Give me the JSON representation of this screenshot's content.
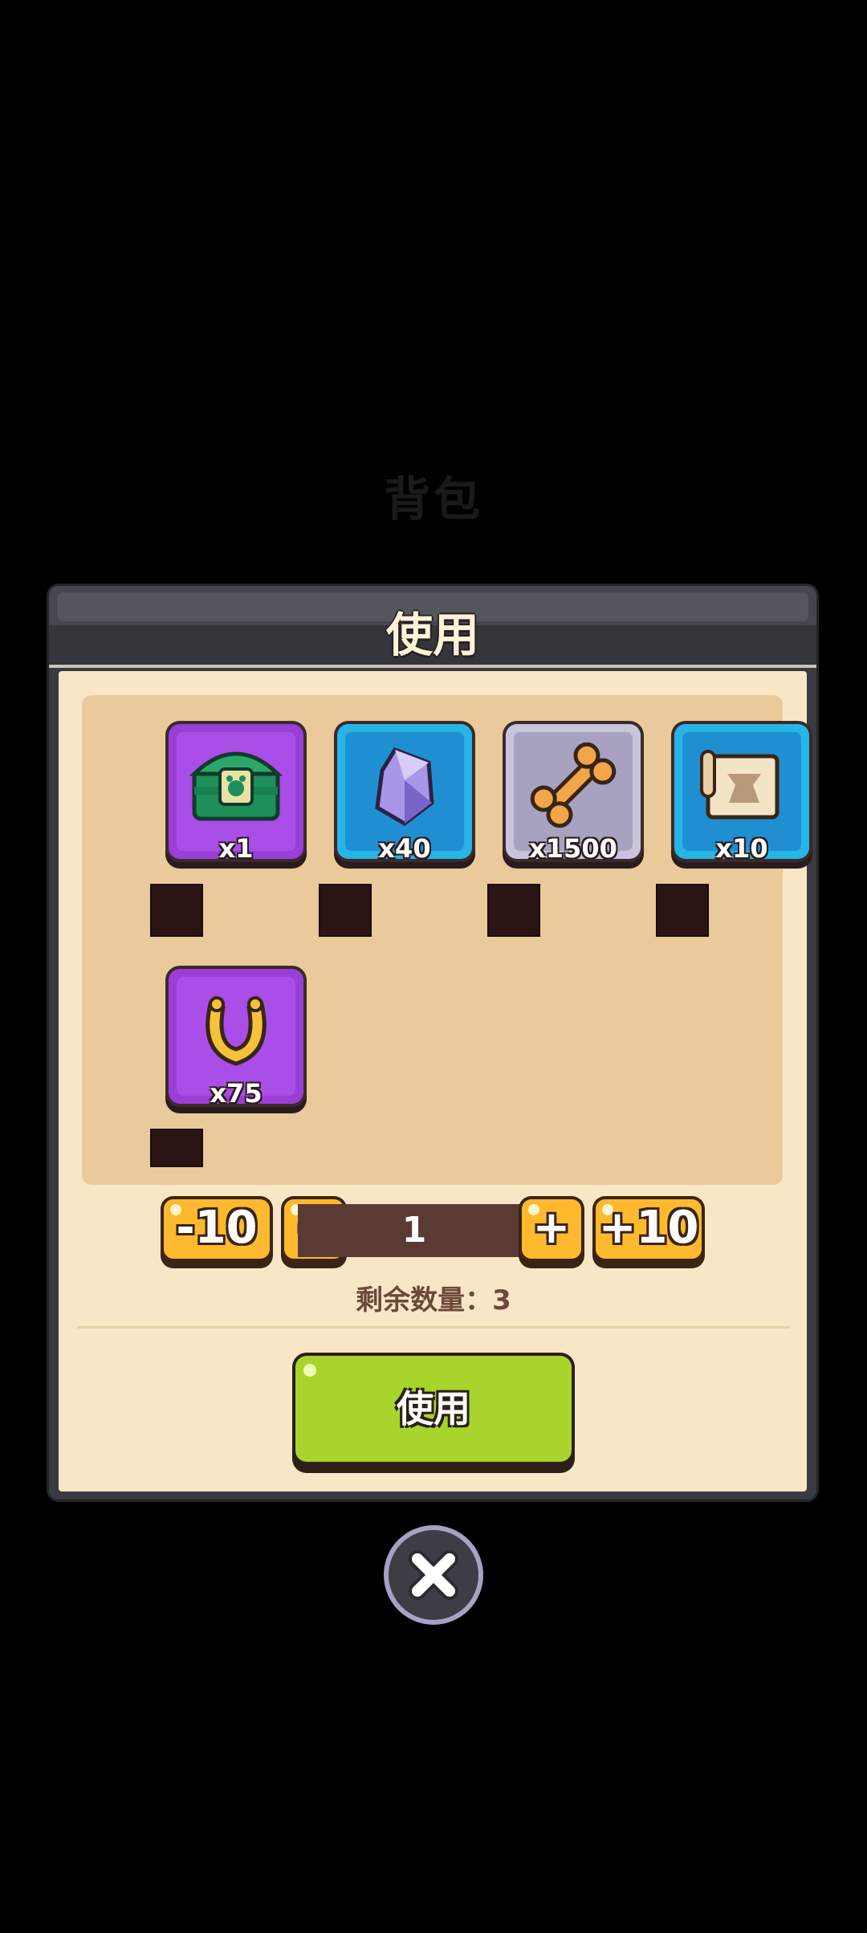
{
  "background_title": "背包",
  "dialog": {
    "title": "使用",
    "items": [
      {
        "name": "green-chest",
        "count": "x1",
        "color": "purple"
      },
      {
        "name": "crystal",
        "count": "x40",
        "color": "blue"
      },
      {
        "name": "bone",
        "count": "x1500",
        "color": "grey"
      },
      {
        "name": "scroll",
        "count": "x10",
        "color": "blue"
      },
      {
        "name": "horseshoe",
        "count": "x75",
        "color": "purple"
      }
    ],
    "controls": {
      "minus_ten": "-10",
      "minus_one": "−",
      "quantity": "1",
      "plus_one": "+",
      "plus_ten": "+10"
    },
    "remaining": "剩余数量：3",
    "use_button": "使用"
  },
  "colors": {
    "paper": "#f8e6c7",
    "panel": "#eac99a",
    "accent_yellow": "#ffb92e",
    "accent_green": "#a9d42c"
  }
}
